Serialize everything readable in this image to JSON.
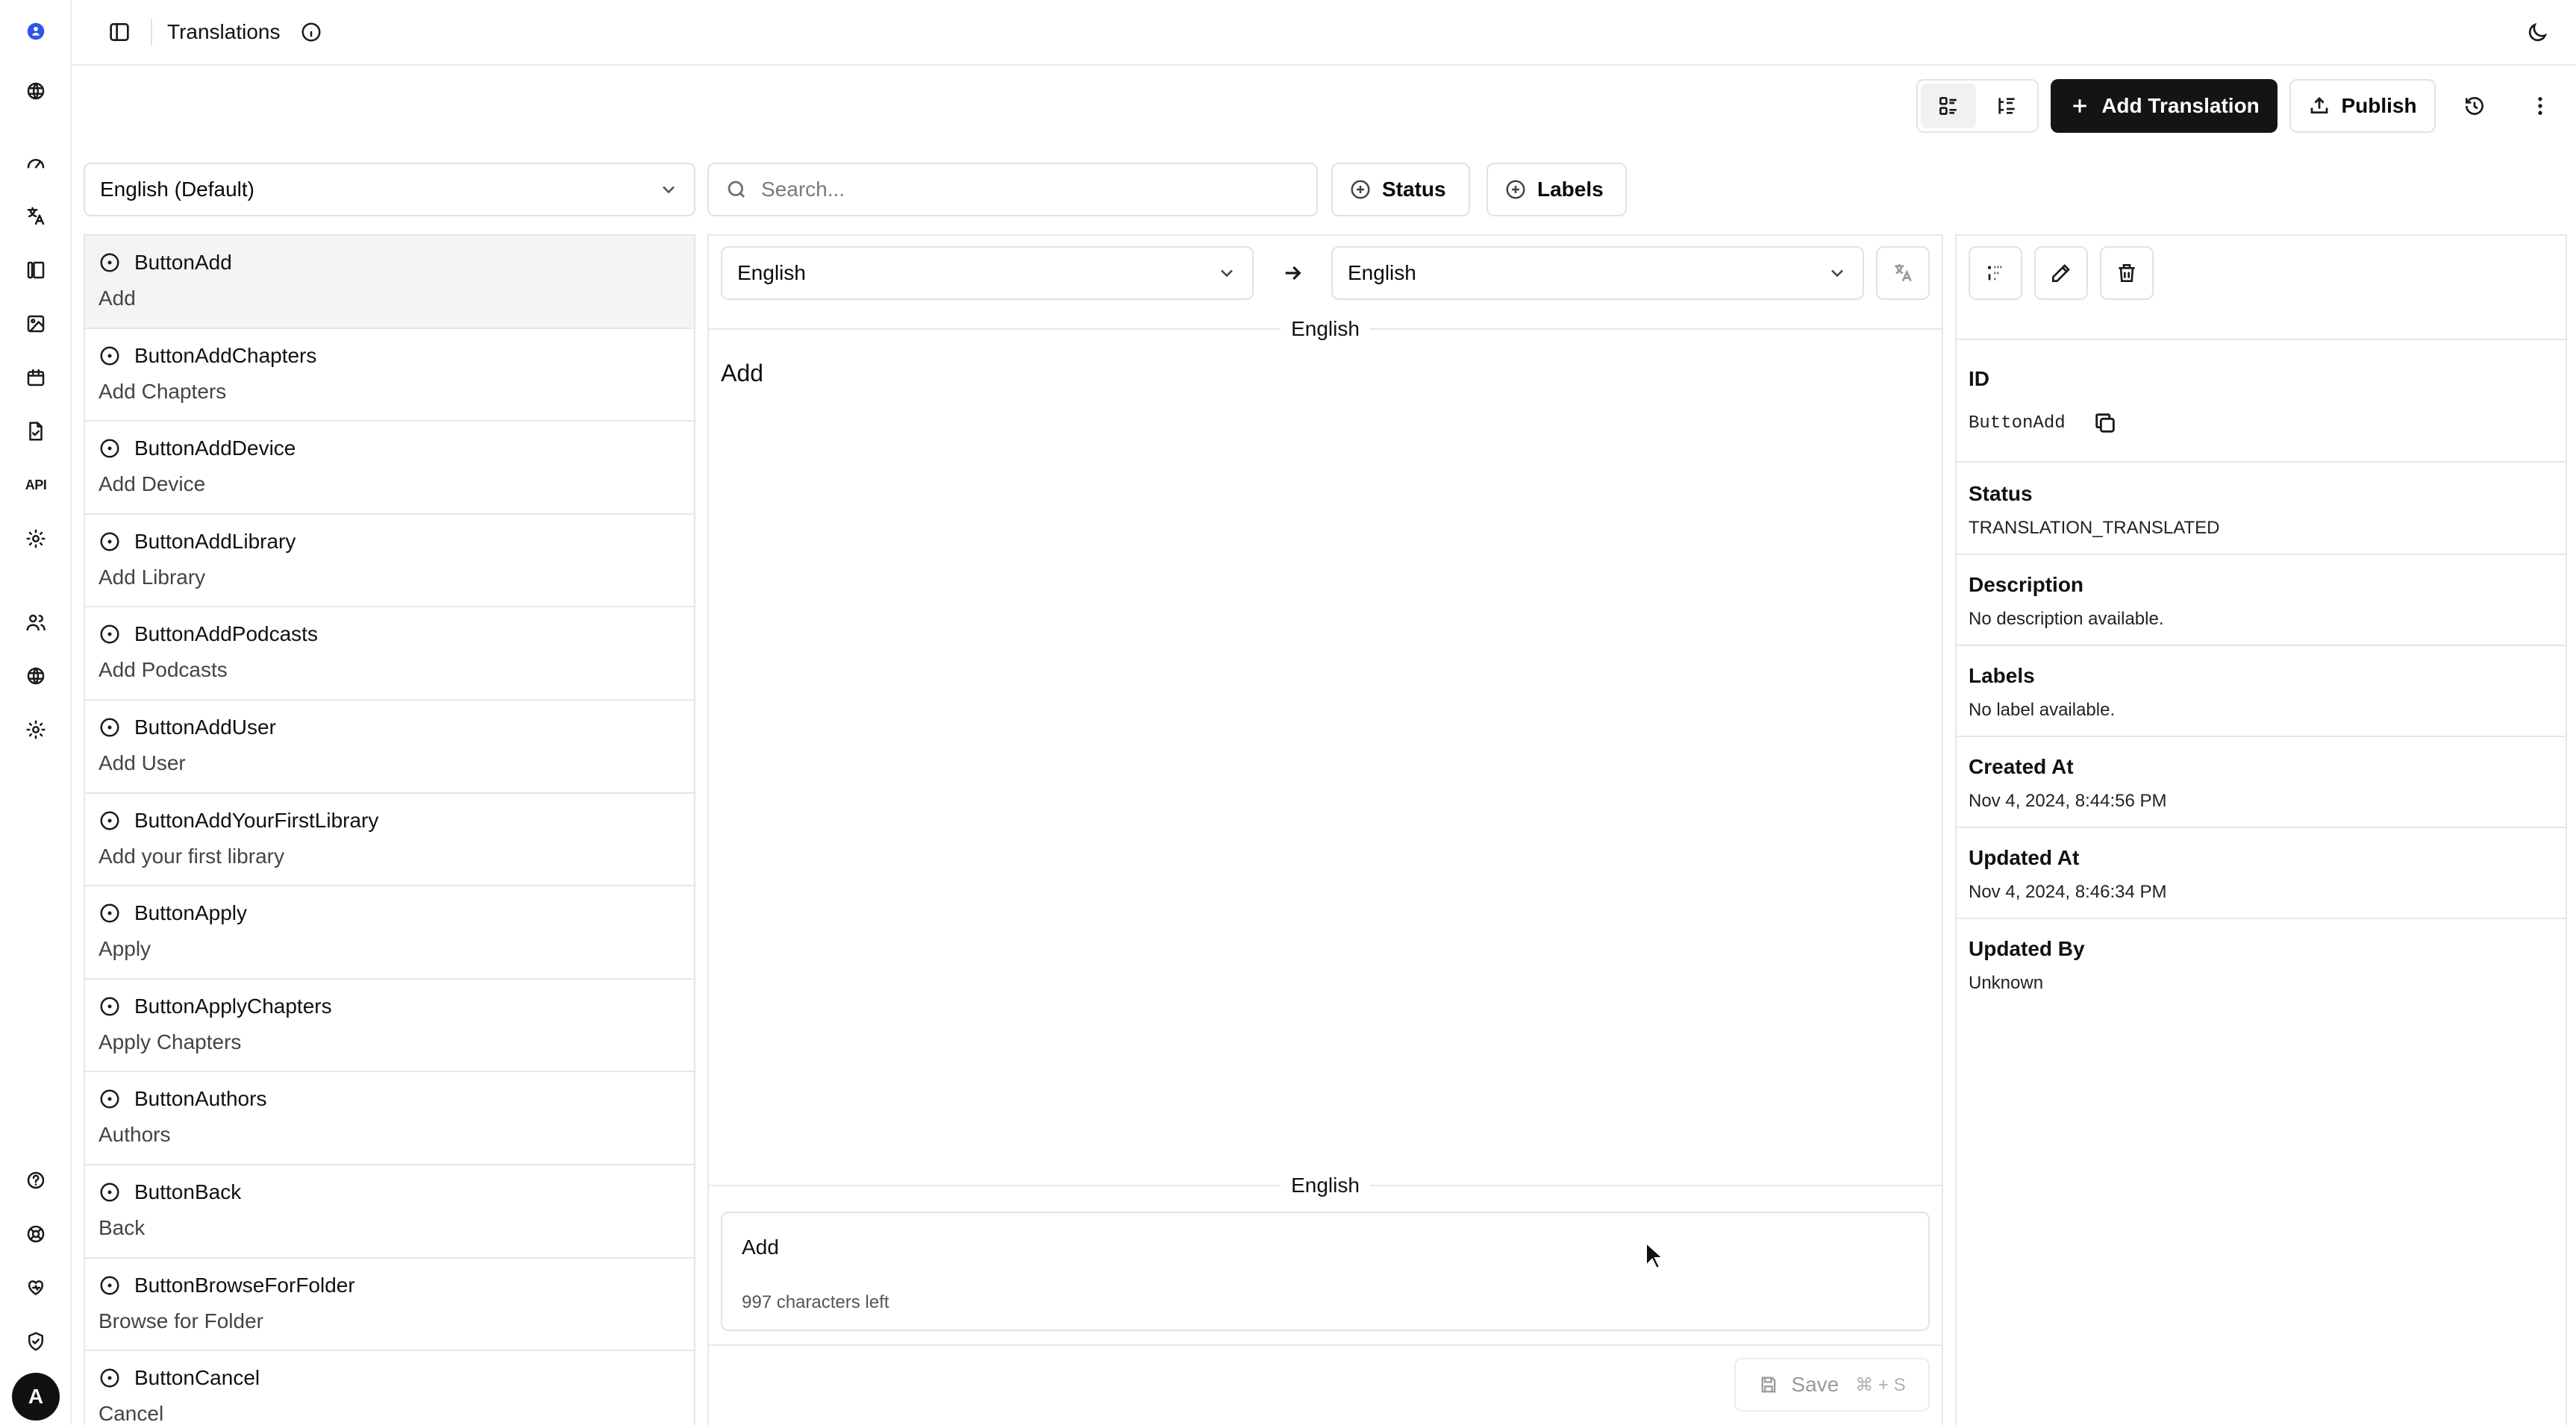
{
  "app": {
    "title": "Translations",
    "avatar_initial": "A"
  },
  "rail": {
    "icons": [
      "logo-icon",
      "globe-icon",
      "dashboard-icon",
      "translate-icon",
      "library-icon",
      "image-icon",
      "calendar-icon",
      "file-icon",
      "api-icon",
      "settings-icon",
      "users-icon",
      "network-icon",
      "cog-icon",
      "help-icon",
      "support-icon",
      "heart-icon",
      "shield-icon"
    ],
    "api_label": "API"
  },
  "toolbar": {
    "add_label": "Add Translation",
    "publish_label": "Publish"
  },
  "filters": {
    "language": "English (Default)",
    "search_placeholder": "Search...",
    "status_label": "Status",
    "labels_label": "Labels"
  },
  "keys": [
    {
      "key": "ButtonAdd",
      "value": "Add"
    },
    {
      "key": "ButtonAddChapters",
      "value": "Add Chapters"
    },
    {
      "key": "ButtonAddDevice",
      "value": "Add Device"
    },
    {
      "key": "ButtonAddLibrary",
      "value": "Add Library"
    },
    {
      "key": "ButtonAddPodcasts",
      "value": "Add Podcasts"
    },
    {
      "key": "ButtonAddUser",
      "value": "Add User"
    },
    {
      "key": "ButtonAddYourFirstLibrary",
      "value": "Add your first library"
    },
    {
      "key": "ButtonApply",
      "value": "Apply"
    },
    {
      "key": "ButtonApplyChapters",
      "value": "Apply Chapters"
    },
    {
      "key": "ButtonAuthors",
      "value": "Authors"
    },
    {
      "key": "ButtonBack",
      "value": "Back"
    },
    {
      "key": "ButtonBrowseForFolder",
      "value": "Browse for Folder"
    },
    {
      "key": "ButtonCancel",
      "value": "Cancel"
    }
  ],
  "editor": {
    "source_lang": "English",
    "target_lang": "English",
    "source_section_label": "English",
    "source_text": "Add",
    "target_section_label": "English",
    "target_value": "Add",
    "chars_left": "997 characters left",
    "save_label": "Save",
    "save_shortcut": "⌘ + S"
  },
  "details": {
    "id_label": "ID",
    "id_value": "ButtonAdd",
    "status_label": "Status",
    "status_value": "TRANSLATION_TRANSLATED",
    "description_label": "Description",
    "description_value": "No description available.",
    "labels_label": "Labels",
    "labels_value": "No label available.",
    "created_label": "Created At",
    "created_value": "Nov 4, 2024, 8:44:56 PM",
    "updated_label": "Updated At",
    "updated_value": "Nov 4, 2024, 8:46:34 PM",
    "updated_by_label": "Updated By",
    "updated_by_value": "Unknown"
  },
  "colors": {
    "primary": "#141414",
    "logo": "#2f54eb",
    "border": "#e6e6e6"
  }
}
